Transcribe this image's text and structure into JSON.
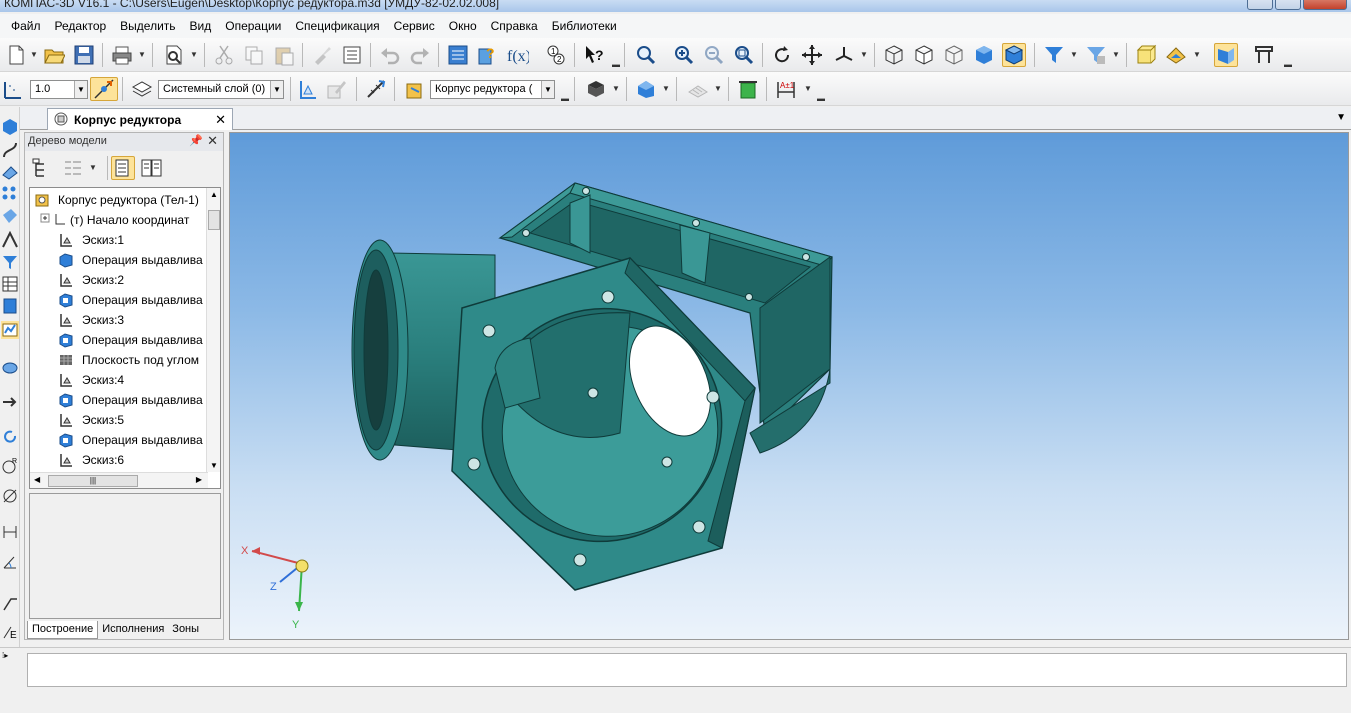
{
  "window": {
    "title": "КОМПАС-3D V16.1 - C:\\Users\\Eugen\\Desktop\\Корпус редуктора.m3d [УМДУ-82-02.02.008]"
  },
  "menu": [
    "Файл",
    "Редактор",
    "Выделить",
    "Вид",
    "Операции",
    "Спецификация",
    "Сервис",
    "Окно",
    "Справка",
    "Библиотеки"
  ],
  "toolbar2": {
    "step_value": "1.0",
    "layer_value": "Системный слой (0)",
    "part_value": "Корпус редуктора ("
  },
  "document_tab": {
    "label": "Корпус редуктора"
  },
  "tree_panel": {
    "title": "Дерево модели",
    "nodes": [
      {
        "label": "Корпус редуктора (Тел-1)",
        "icon": "part-icon"
      },
      {
        "label": "(т) Начало координат",
        "icon": "origin-icon"
      },
      {
        "label": "Эскиз:1",
        "icon": "sketch-icon"
      },
      {
        "label": "Операция выдавлива",
        "icon": "extrude-icon"
      },
      {
        "label": "Эскиз:2",
        "icon": "sketch-icon"
      },
      {
        "label": "Операция выдавлива",
        "icon": "extrude-icon"
      },
      {
        "label": "Эскиз:3",
        "icon": "sketch-icon"
      },
      {
        "label": "Операция выдавлива",
        "icon": "extrude-icon"
      },
      {
        "label": "Плоскость под углом",
        "icon": "plane-icon"
      },
      {
        "label": "Эскиз:4",
        "icon": "sketch-icon"
      },
      {
        "label": "Операция выдавлива",
        "icon": "extrude-icon"
      },
      {
        "label": "Эскиз:5",
        "icon": "sketch-icon"
      },
      {
        "label": "Операция выдавлива",
        "icon": "extrude-icon"
      },
      {
        "label": "Эскиз:6",
        "icon": "sketch-icon"
      }
    ],
    "tabs": [
      "Построение",
      "Исполнения",
      "Зоны"
    ]
  },
  "axes": {
    "x": "X",
    "y": "Y",
    "z": "Z"
  },
  "colors": {
    "model": "#2f8a89",
    "model_dark": "#1d5e5e",
    "model_light": "#44a3a0",
    "accent": "#fde39a"
  }
}
